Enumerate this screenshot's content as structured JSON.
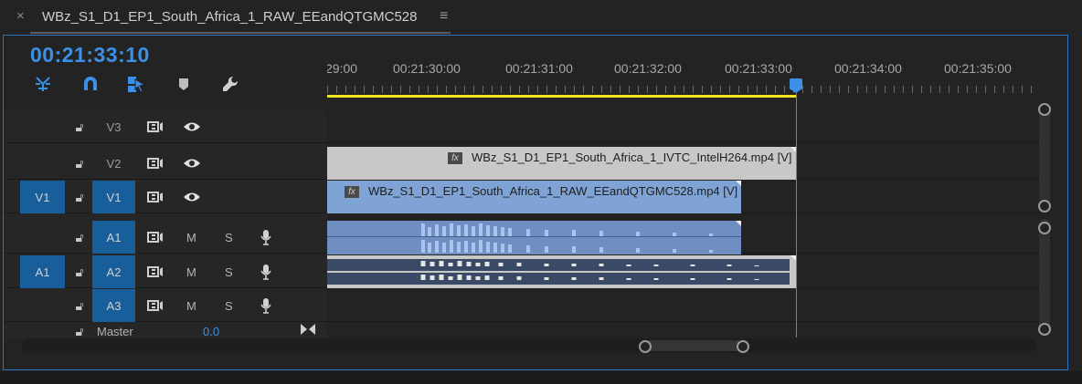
{
  "tab": {
    "close_icon": "×",
    "title": "WBz_S1_D1_EP1_South_Africa_1_RAW_EEandQTGMC528",
    "menu_icon": "≡"
  },
  "timecode": "00:21:33:10",
  "toolbar": {
    "icons": [
      "insert-overwrite-icon",
      "snap-magnet-icon",
      "linked-selection-icon",
      "add-marker-icon",
      "settings-wrench-icon"
    ]
  },
  "ruler": {
    "labels": [
      "29:00",
      "00:21:30:00",
      "00:21:31:00",
      "00:21:32:00",
      "00:21:33:00",
      "00:21:34:00",
      "00:21:35:00"
    ]
  },
  "tracks": {
    "video": [
      {
        "name": "V3",
        "source": "",
        "targeted": false
      },
      {
        "name": "V2",
        "source": "",
        "targeted": false
      },
      {
        "name": "V1",
        "source": "V1",
        "targeted": true
      }
    ],
    "audio": [
      {
        "name": "A1",
        "source": "",
        "targeted": true,
        "mute": "M",
        "solo": "S"
      },
      {
        "name": "A2",
        "source": "A1",
        "targeted": true,
        "mute": "M",
        "solo": "S"
      },
      {
        "name": "A3",
        "source": "",
        "targeted": true,
        "mute": "M",
        "solo": "S"
      }
    ],
    "master": {
      "name": "Master",
      "value": "0.0"
    }
  },
  "clips": {
    "v2": "WBz_S1_D1_EP1_South_Africa_1_IVTC_IntelH264.mp4 [V]",
    "v1": "WBz_S1_D1_EP1_South_Africa_1_RAW_EEandQTGMC528.mp4 [V]",
    "fx_label": "fx"
  },
  "colors": {
    "accent": "#3b90e8",
    "track_target": "#175e9a",
    "work_area": "#f2e321",
    "video_clip_v1": "#7fa3d4",
    "video_clip_v2": "#c8c8c8",
    "audio_clip": "#6f8fc2"
  }
}
